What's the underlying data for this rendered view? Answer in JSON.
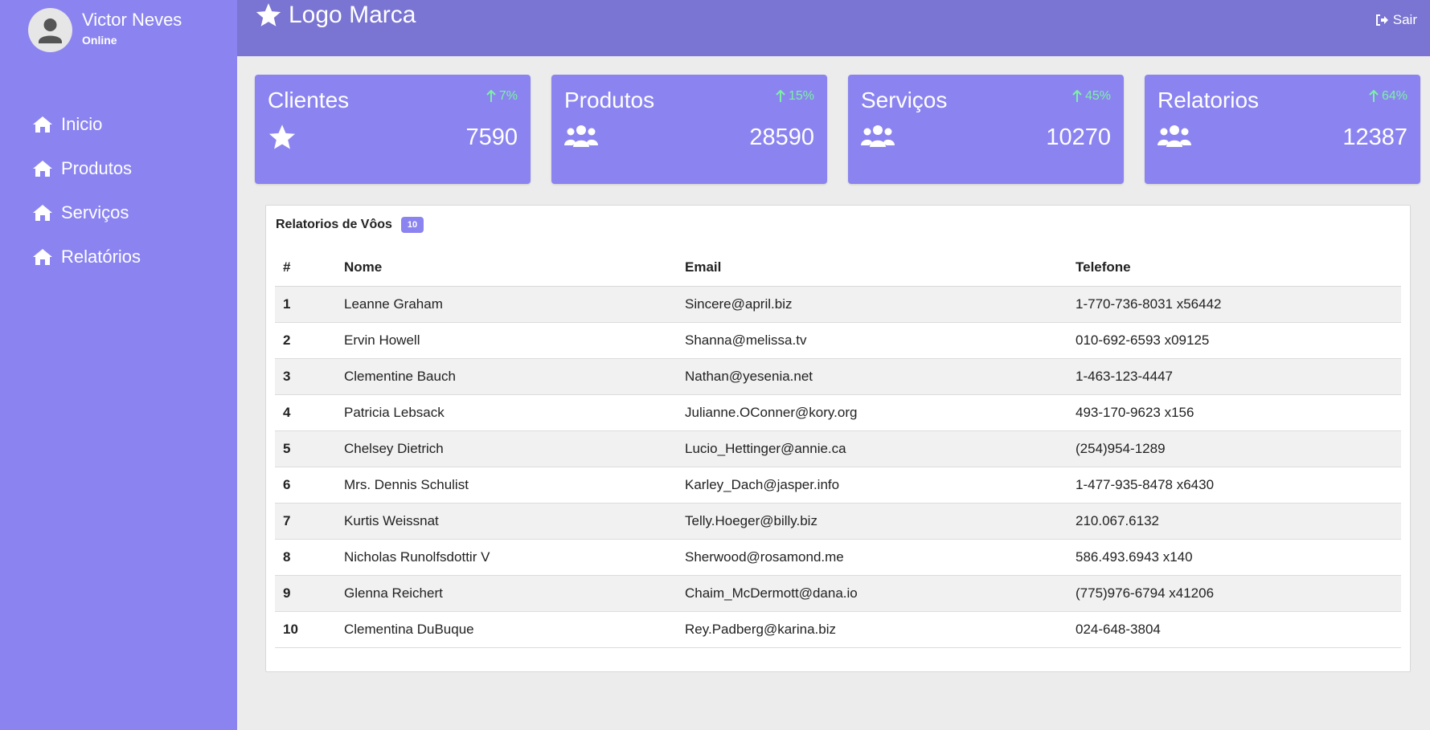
{
  "user": {
    "name": "Victor Neves",
    "status": "Online"
  },
  "nav": [
    {
      "label": "Inicio",
      "icon": "home-icon"
    },
    {
      "label": "Produtos",
      "icon": "home-icon"
    },
    {
      "label": "Serviços",
      "icon": "home-icon"
    },
    {
      "label": "Relatórios",
      "icon": "home-icon"
    }
  ],
  "header": {
    "brand": "Logo Marca",
    "logout": "Sair"
  },
  "cards": [
    {
      "title": "Clientes",
      "change": "7%",
      "value": "7590",
      "icon": "star-icon"
    },
    {
      "title": "Produtos",
      "change": "15%",
      "value": "28590",
      "icon": "users-icon"
    },
    {
      "title": "Serviços",
      "change": "45%",
      "value": "10270",
      "icon": "users-icon"
    },
    {
      "title": "Relatorios",
      "change": "64%",
      "value": "12387",
      "icon": "users-icon"
    }
  ],
  "table": {
    "title": "Relatorios de Vôos",
    "count": "10",
    "columns": [
      "#",
      "Nome",
      "Email",
      "Telefone"
    ],
    "rows": [
      [
        "1",
        "Leanne Graham",
        "Sincere@april.biz",
        "1-770-736-8031 x56442"
      ],
      [
        "2",
        "Ervin Howell",
        "Shanna@melissa.tv",
        "010-692-6593 x09125"
      ],
      [
        "3",
        "Clementine Bauch",
        "Nathan@yesenia.net",
        "1-463-123-4447"
      ],
      [
        "4",
        "Patricia Lebsack",
        "Julianne.OConner@kory.org",
        "493-170-9623 x156"
      ],
      [
        "5",
        "Chelsey Dietrich",
        "Lucio_Hettinger@annie.ca",
        "(254)954-1289"
      ],
      [
        "6",
        "Mrs. Dennis Schulist",
        "Karley_Dach@jasper.info",
        "1-477-935-8478 x6430"
      ],
      [
        "7",
        "Kurtis Weissnat",
        "Telly.Hoeger@billy.biz",
        "210.067.6132"
      ],
      [
        "8",
        "Nicholas Runolfsdottir V",
        "Sherwood@rosamond.me",
        "586.493.6943 x140"
      ],
      [
        "9",
        "Glenna Reichert",
        "Chaim_McDermott@dana.io",
        "(775)976-6794 x41206"
      ],
      [
        "10",
        "Clementina DuBuque",
        "Rey.Padberg@karina.biz",
        "024-648-3804"
      ]
    ]
  },
  "colors": {
    "sidebar": "#8b84f0",
    "header": "#7a74d2",
    "card": "#8b84f0",
    "positive_change": "#7ef0a6"
  }
}
